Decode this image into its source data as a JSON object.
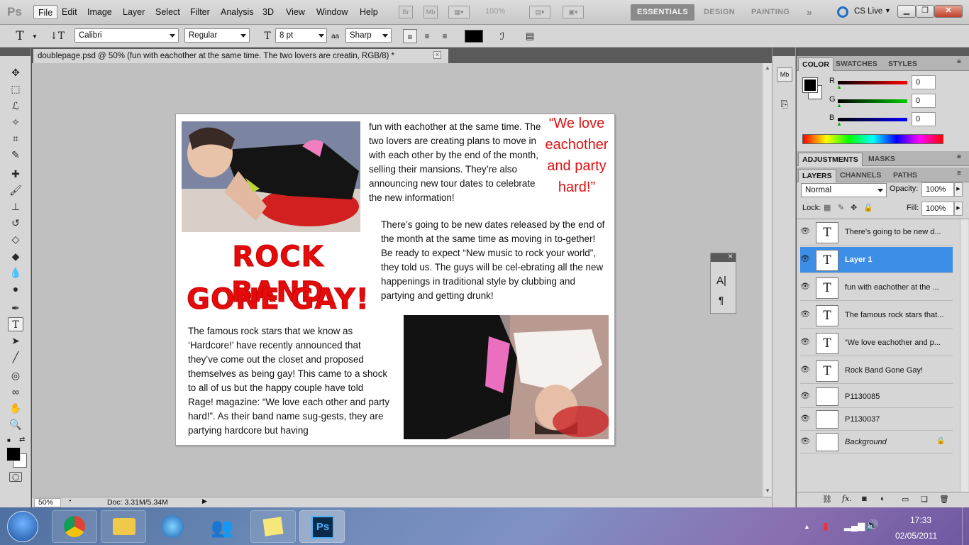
{
  "app": {
    "logo": "Ps"
  },
  "menu": [
    "File",
    "Edit",
    "Image",
    "Layer",
    "Select",
    "Filter",
    "Analysis",
    "3D",
    "View",
    "Window",
    "Help"
  ],
  "menubar_right": {
    "zoom_readout": "100%",
    "workspaces": [
      "ESSENTIALS",
      "DESIGN",
      "PAINTING"
    ],
    "overflow": "»",
    "cs_live": "CS Live"
  },
  "options": {
    "font_family": "Calibri",
    "font_style": "Regular",
    "font_size": "8 pt",
    "aa_icon": "aa",
    "antialias": "Sharp"
  },
  "document": {
    "tab_title": "doublepage.psd @ 50% (fun with eachother at the same time. The two lovers are creatin, RGB/8) *",
    "close": "×"
  },
  "page": {
    "col1_top": "fun with eachother at the same time. The two lovers are creating plans to move in with each other by the end of the month, selling their mansions. They’re also announcing new tour dates to celebrate the new information!",
    "quote": "“We love eachother and party hard!”",
    "col2_mid": "There’s going to be new dates released by the end of the month at the same time as moving in to-gether! Be ready to expect “New music to rock your world”, they told us. The guys will be cel-ebrating all the new happenings in traditional style by clubbing and partying and getting drunk!",
    "headline_line1": "ROCK BAND",
    "headline_line2": "GONE GAY!",
    "col_bottom": "The famous rock stars that we know as ‘Hardcore!’ have recently announced that they’ve come out the closet and proposed themselves as being gay! This came to a shock to all of us but the happy couple have told Rage! magazine: “We love each other and party hard!”. As their band name sug-gests, they are partying hardcore but having"
  },
  "status": {
    "zoom": "50%",
    "doc_info": "Doc: 3.31M/5.34M"
  },
  "color_panel": {
    "tabs": [
      "COLOR",
      "SWATCHES",
      "STYLES"
    ],
    "channels": [
      {
        "label": "R",
        "value": "0"
      },
      {
        "label": "G",
        "value": "0"
      },
      {
        "label": "B",
        "value": "0"
      }
    ]
  },
  "adjustments_panel": {
    "tabs": [
      "ADJUSTMENTS",
      "MASKS"
    ]
  },
  "layers_panel": {
    "tabs": [
      "LAYERS",
      "CHANNELS",
      "PATHS"
    ],
    "blend_mode": "Normal",
    "opacity_label": "Opacity:",
    "opacity": "100%",
    "lock_label": "Lock:",
    "fill_label": "Fill:",
    "fill": "100%",
    "layers": [
      {
        "name": "There’s going to be new d...",
        "type": "text"
      },
      {
        "name": "Layer 1",
        "type": "text",
        "selected": true
      },
      {
        "name": "fun with eachother at the ...",
        "type": "text"
      },
      {
        "name": "The famous rock stars that...",
        "type": "text"
      },
      {
        "name": "“We love  eachother and p...",
        "type": "text"
      },
      {
        "name": "Rock Band Gone Gay!",
        "type": "text"
      },
      {
        "name": "P1130085",
        "type": "image"
      },
      {
        "name": "P1130037",
        "type": "image"
      },
      {
        "name": "Background",
        "type": "background"
      }
    ],
    "footer_fx": "fx."
  },
  "taskbar": {
    "clock_time": "17:33",
    "clock_date": "02/05/2011",
    "pinned": [
      "start-orb",
      "chrome",
      "explorer",
      "itunes",
      "messenger",
      "sticky-notes",
      "photoshop"
    ]
  },
  "colors": {
    "accent_red": "#e30b0b",
    "selection_blue": "#3c8ee6",
    "panel_grey": "#d6d6d6"
  }
}
